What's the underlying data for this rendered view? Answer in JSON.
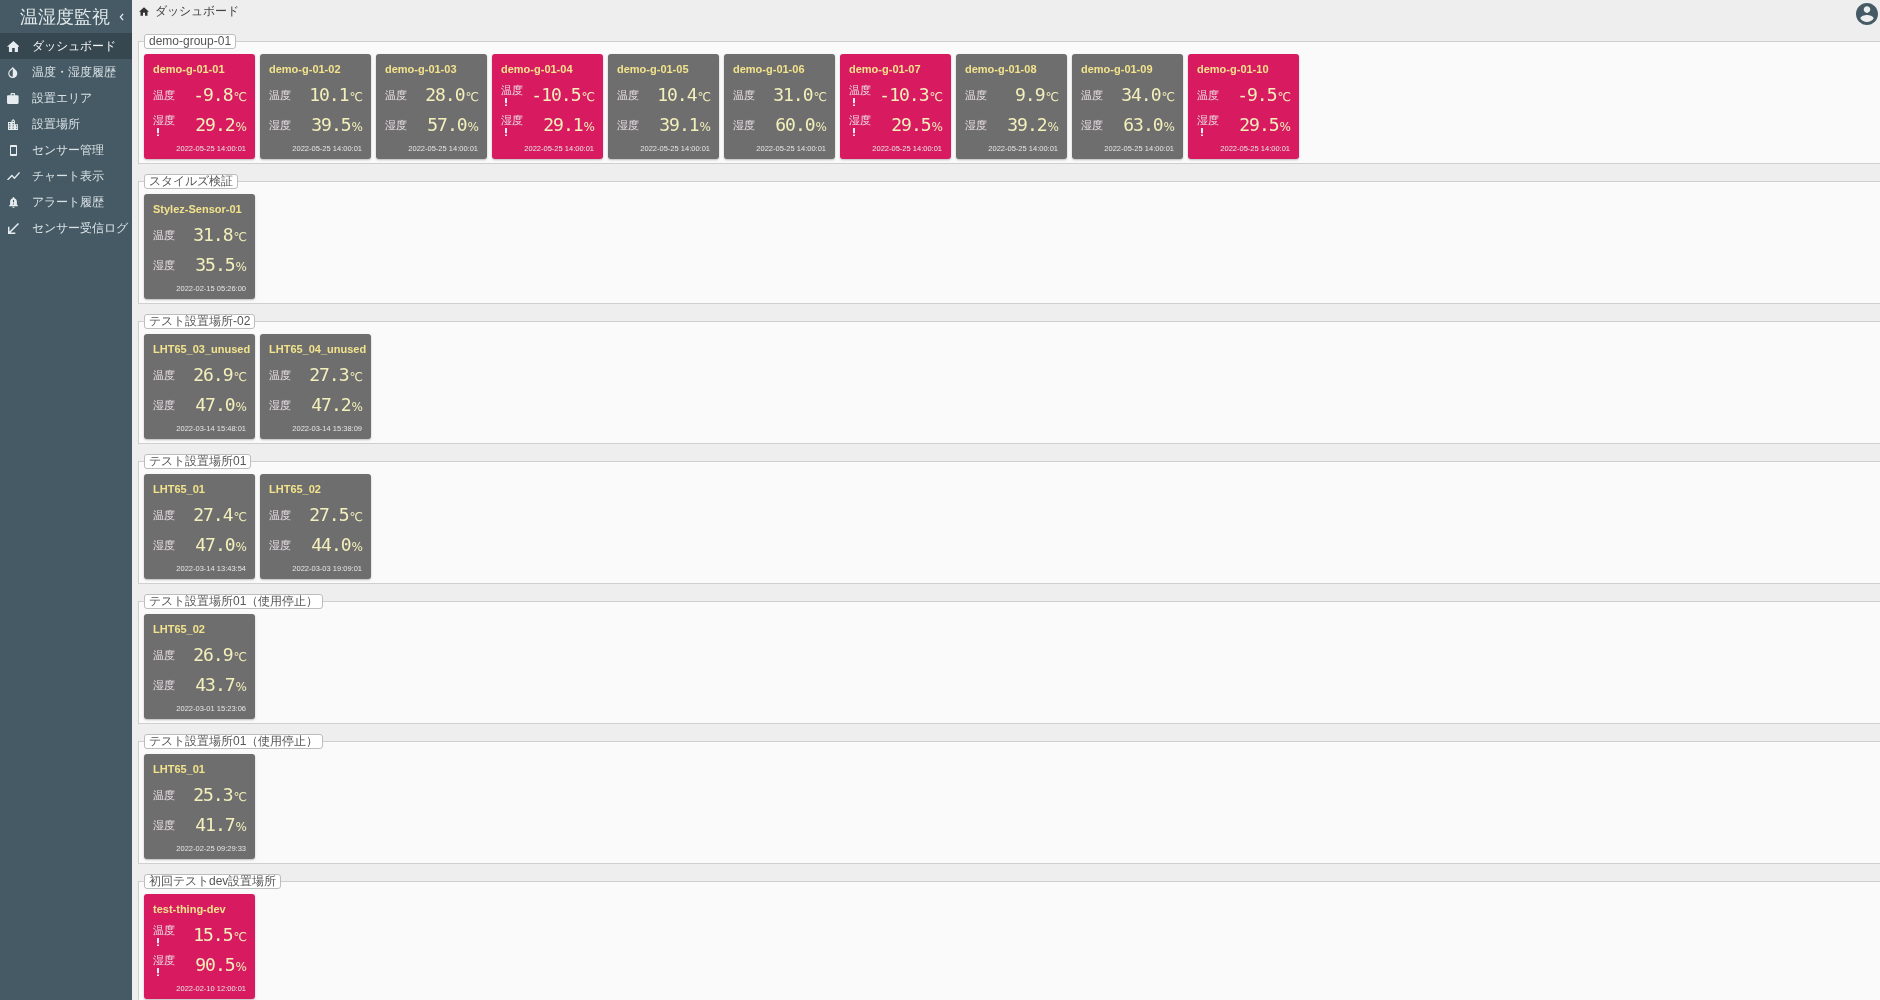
{
  "sidebar": {
    "title": "温湿度監視",
    "items": [
      {
        "label": "ダッシュボード",
        "selected": true
      },
      {
        "label": "温度・湿度履歴",
        "selected": false
      },
      {
        "label": "設置エリア",
        "selected": false
      },
      {
        "label": "設置場所",
        "selected": false
      },
      {
        "label": "センサー管理",
        "selected": false
      },
      {
        "label": "チャート表示",
        "selected": false
      },
      {
        "label": "アラート履歴",
        "selected": false
      },
      {
        "label": "センサー受信ログ",
        "selected": false
      }
    ]
  },
  "breadcrumb": {
    "label": "ダッシュボード"
  },
  "groups": [
    {
      "name": "demo-group-01",
      "sensors": [
        {
          "name": "demo-g-01-01",
          "alert": true,
          "readings": [
            {
              "label": "温度",
              "value": "-9.8",
              "unit": "℃",
              "alert": false
            },
            {
              "label": "湿度",
              "value": "29.2",
              "unit": "%",
              "alert": true
            }
          ],
          "updated": "2022-05-25 14:00:01"
        },
        {
          "name": "demo-g-01-02",
          "alert": false,
          "readings": [
            {
              "label": "温度",
              "value": "10.1",
              "unit": "℃",
              "alert": false
            },
            {
              "label": "湿度",
              "value": "39.5",
              "unit": "%",
              "alert": false
            }
          ],
          "updated": "2022-05-25 14:00:01"
        },
        {
          "name": "demo-g-01-03",
          "alert": false,
          "readings": [
            {
              "label": "温度",
              "value": "28.0",
              "unit": "℃",
              "alert": false
            },
            {
              "label": "湿度",
              "value": "57.0",
              "unit": "%",
              "alert": false
            }
          ],
          "updated": "2022-05-25 14:00:01"
        },
        {
          "name": "demo-g-01-04",
          "alert": true,
          "readings": [
            {
              "label": "温度",
              "value": "-10.5",
              "unit": "℃",
              "alert": true
            },
            {
              "label": "湿度",
              "value": "29.1",
              "unit": "%",
              "alert": true
            }
          ],
          "updated": "2022-05-25 14:00:01"
        },
        {
          "name": "demo-g-01-05",
          "alert": false,
          "readings": [
            {
              "label": "温度",
              "value": "10.4",
              "unit": "℃",
              "alert": false
            },
            {
              "label": "湿度",
              "value": "39.1",
              "unit": "%",
              "alert": false
            }
          ],
          "updated": "2022-05-25 14:00:01"
        },
        {
          "name": "demo-g-01-06",
          "alert": false,
          "readings": [
            {
              "label": "温度",
              "value": "31.0",
              "unit": "℃",
              "alert": false
            },
            {
              "label": "湿度",
              "value": "60.0",
              "unit": "%",
              "alert": false
            }
          ],
          "updated": "2022-05-25 14:00:01"
        },
        {
          "name": "demo-g-01-07",
          "alert": true,
          "readings": [
            {
              "label": "温度",
              "value": "-10.3",
              "unit": "℃",
              "alert": true
            },
            {
              "label": "湿度",
              "value": "29.5",
              "unit": "%",
              "alert": true
            }
          ],
          "updated": "2022-05-25 14:00:01"
        },
        {
          "name": "demo-g-01-08",
          "alert": false,
          "readings": [
            {
              "label": "温度",
              "value": "9.9",
              "unit": "℃",
              "alert": false
            },
            {
              "label": "湿度",
              "value": "39.2",
              "unit": "%",
              "alert": false
            }
          ],
          "updated": "2022-05-25 14:00:01"
        },
        {
          "name": "demo-g-01-09",
          "alert": false,
          "readings": [
            {
              "label": "温度",
              "value": "34.0",
              "unit": "℃",
              "alert": false
            },
            {
              "label": "湿度",
              "value": "63.0",
              "unit": "%",
              "alert": false
            }
          ],
          "updated": "2022-05-25 14:00:01"
        },
        {
          "name": "demo-g-01-10",
          "alert": true,
          "readings": [
            {
              "label": "温度",
              "value": "-9.5",
              "unit": "℃",
              "alert": false
            },
            {
              "label": "湿度",
              "value": "29.5",
              "unit": "%",
              "alert": true
            }
          ],
          "updated": "2022-05-25 14:00:01"
        }
      ]
    },
    {
      "name": "スタイルズ検証",
      "sensors": [
        {
          "name": "Stylez-Sensor-01",
          "alert": false,
          "readings": [
            {
              "label": "温度",
              "value": "31.8",
              "unit": "℃",
              "alert": false
            },
            {
              "label": "湿度",
              "value": "35.5",
              "unit": "%",
              "alert": false
            }
          ],
          "updated": "2022-02-15 05:26:00"
        }
      ]
    },
    {
      "name": "テスト設置場所-02",
      "sensors": [
        {
          "name": "LHT65_03_unused",
          "alert": false,
          "readings": [
            {
              "label": "温度",
              "value": "26.9",
              "unit": "℃",
              "alert": false
            },
            {
              "label": "湿度",
              "value": "47.0",
              "unit": "%",
              "alert": false
            }
          ],
          "updated": "2022-03-14 15:48:01"
        },
        {
          "name": "LHT65_04_unused",
          "alert": false,
          "readings": [
            {
              "label": "温度",
              "value": "27.3",
              "unit": "℃",
              "alert": false
            },
            {
              "label": "湿度",
              "value": "47.2",
              "unit": "%",
              "alert": false
            }
          ],
          "updated": "2022-03-14 15:38:09"
        }
      ]
    },
    {
      "name": "テスト設置場所01",
      "sensors": [
        {
          "name": "LHT65_01",
          "alert": false,
          "readings": [
            {
              "label": "温度",
              "value": "27.4",
              "unit": "℃",
              "alert": false
            },
            {
              "label": "湿度",
              "value": "47.0",
              "unit": "%",
              "alert": false
            }
          ],
          "updated": "2022-03-14 13:43:54"
        },
        {
          "name": "LHT65_02",
          "alert": false,
          "readings": [
            {
              "label": "温度",
              "value": "27.5",
              "unit": "℃",
              "alert": false
            },
            {
              "label": "湿度",
              "value": "44.0",
              "unit": "%",
              "alert": false
            }
          ],
          "updated": "2022-03-03 19:09:01"
        }
      ]
    },
    {
      "name": "テスト設置場所01（使用停止）",
      "sensors": [
        {
          "name": "LHT65_02",
          "alert": false,
          "readings": [
            {
              "label": "温度",
              "value": "26.9",
              "unit": "℃",
              "alert": false
            },
            {
              "label": "湿度",
              "value": "43.7",
              "unit": "%",
              "alert": false
            }
          ],
          "updated": "2022-03-01 15:23:06"
        }
      ]
    },
    {
      "name": "テスト設置場所01（使用停止）",
      "sensors": [
        {
          "name": "LHT65_01",
          "alert": false,
          "readings": [
            {
              "label": "温度",
              "value": "25.3",
              "unit": "℃",
              "alert": false
            },
            {
              "label": "湿度",
              "value": "41.7",
              "unit": "%",
              "alert": false
            }
          ],
          "updated": "2022-02-25 09:29:33"
        }
      ]
    },
    {
      "name": "初回テストdev設置場所",
      "sensors": [
        {
          "name": "test-thing-dev",
          "alert": true,
          "readings": [
            {
              "label": "温度",
              "value": "15.5",
              "unit": "℃",
              "alert": true
            },
            {
              "label": "湿度",
              "value": "90.5",
              "unit": "%",
              "alert": true
            }
          ],
          "updated": "2022-02-10 12:00:01"
        }
      ]
    }
  ]
}
